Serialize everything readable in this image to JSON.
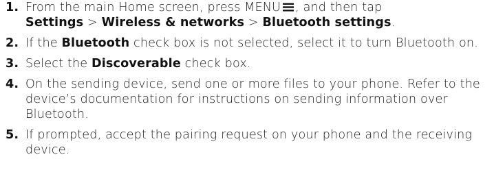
{
  "steps": [
    {
      "number": "1.",
      "text_a": "From the main Home screen, press MENU",
      "icon": "menu-icon",
      "text_b": ", and then tap",
      "path_settings": "Settings",
      "sep1": " > ",
      "path_wireless": "Wireless & networks",
      "sep2": " > ",
      "path_bluetooth": "Bluetooth settings",
      "end": "."
    },
    {
      "number": "2.",
      "text_a": "If the ",
      "bold": "Bluetooth",
      "text_b": " check box is not selected, select it to turn Bluetooth on."
    },
    {
      "number": "3.",
      "text_a": "Select the ",
      "bold": "Discoverable",
      "text_b": " check box."
    },
    {
      "number": "4.",
      "text": "On the sending device, send one or more files to your phone. Refer to the device’s documentation for instructions on sending information over Bluetooth."
    },
    {
      "number": "5.",
      "text": "If prompted, accept the pairing request on your phone and the receiving device."
    }
  ],
  "colors": {
    "text": "#1a1a1a",
    "emphasis": "#111111",
    "background": "#ffffff"
  }
}
